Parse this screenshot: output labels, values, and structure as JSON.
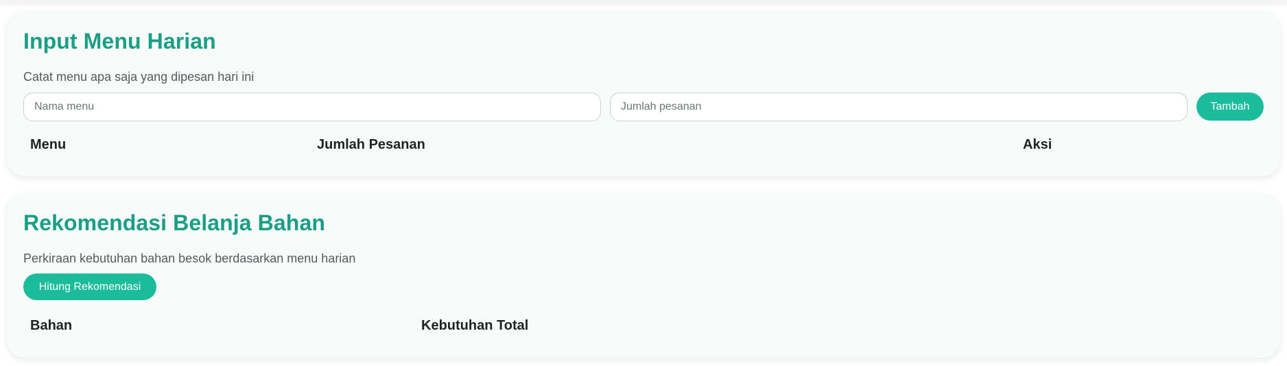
{
  "input_section": {
    "title": "Input Menu Harian",
    "subtitle": "Catat menu apa saja yang dipesan hari ini",
    "menu_input": {
      "placeholder": "Nama menu",
      "value": ""
    },
    "qty_input": {
      "placeholder": "Jumlah pesanan",
      "value": ""
    },
    "add_button_label": "Tambah",
    "table": {
      "columns": [
        "Menu",
        "Jumlah Pesanan",
        "Aksi"
      ],
      "rows": []
    }
  },
  "recommendation_section": {
    "title": "Rekomendasi Belanja Bahan",
    "subtitle": "Perkiraan kebutuhan bahan besok berdasarkan menu harian",
    "calculate_button_label": "Hitung Rekomendasi",
    "table": {
      "columns": [
        "Bahan",
        "Kebutuhan Total"
      ],
      "rows": []
    }
  },
  "colors": {
    "accent": "#1bbc9b",
    "title": "#1a9e85",
    "card_background": "#f7fbfa"
  }
}
